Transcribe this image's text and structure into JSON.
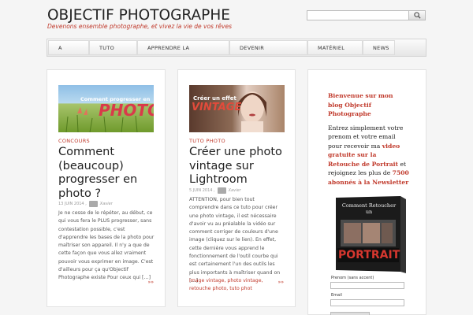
{
  "site": {
    "title": "OBJECTIF PHOTOGRAPHE",
    "tagline": "Devenons ensemble photographe, et vivez la vie de vos rêves"
  },
  "search": {
    "placeholder": "",
    "icon": "search-icon"
  },
  "nav": {
    "items": [
      {
        "label": "A"
      },
      {
        "label": "TUTO"
      },
      {
        "label": "APPRENDRE LA"
      },
      {
        "label": "DEVENIR"
      },
      {
        "label": "MATÉRIEL"
      },
      {
        "label": "NEWS"
      }
    ]
  },
  "posts": [
    {
      "image_text_top": "Comment progresser en",
      "image_text_main": "PHOTO",
      "category": "CONCOURS",
      "title": "Comment (beaucoup) progresser en photo ?",
      "date": "13 JUIN 2014 ,",
      "comments": "",
      "author": "Xavier",
      "excerpt": "Je ne cesse de le répéter, au début, ce qui vous fera le PLUS progresser, sans contestation possible, c'est d'apprendre les bases de la photo pour maîtriser son appareil. Il n'y a que de cette façon que vous allez vraiment pouvoir vous exprimer en image. C'est d'ailleurs pour ça qu'Objectif Photographe existe Pour ceux qui […]",
      "more": "»»"
    },
    {
      "image_text_top": "Créer un effet",
      "image_text_main": "VINTAGE",
      "category": "TUTO PHOTO",
      "title": "Créer une photo vintage sur Lightroom",
      "date": "5 JUIN 2014 ,",
      "comments": "",
      "author": "Xavier",
      "excerpt": "ATTENTION, pour bien tout comprendre dans ce tuto pour créer une photo vintage, il est nécessaire d'avoir vu au préalable la vidéo sur comment corriger de couleurs d'une image (cliquez sur le lien). En effet, cette dernière vous apprend le fonctionnement de l'outil courbe qui est certainement l'un des outils les plus importants à maîtriser quand on […]",
      "more": "»»",
      "tags": "image vintage, photo vintage, retouche photo, tuto phot"
    }
  ],
  "sidebar": {
    "heading": "Bienvenue sur mon blog Objectif Photographe",
    "text_1": "Entrez simplement votre prenom et votre email pour recevoir ma",
    "link_1": "video gratuite sur la Retouche de Portrait",
    "text_2": "et rejoignez les plus de",
    "link_2": "7500 abonnés à la Newsletter",
    "product_title": "Comment Retoucher un",
    "product_main": "PORTRAIT",
    "form": {
      "name_label": "Prenom (sans accent)",
      "email_label": "Email"
    }
  },
  "colors": {
    "accent": "#c0392b",
    "background": "#f5f5f5"
  }
}
